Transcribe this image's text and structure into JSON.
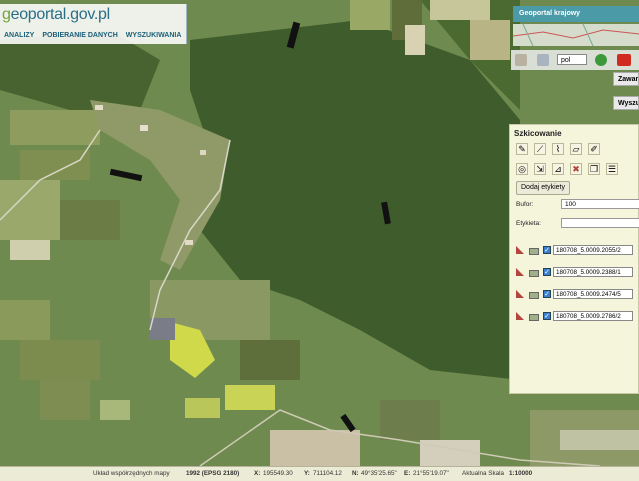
{
  "header": {
    "logo_main": "eoportal.gov.pl",
    "menu": [
      "ANALIZY",
      "POBIERANIE DANYCH",
      "WYSZUKIWANIA"
    ]
  },
  "right_panel": {
    "title": "Geoportal krajowy",
    "language": "pol",
    "side_buttons": [
      "Zawar",
      "Wyszu"
    ]
  },
  "sketch_panel": {
    "title": "Szkicowanie",
    "add_labels_button": "Dodaj etykiety",
    "buffer_label": "Bufor:",
    "buffer_value": "100",
    "label_label": "Etykieta:",
    "label_value": "",
    "rows": [
      "180708_5.0009.2055/2",
      "180708_5.0009.2388/1",
      "180708_5.0009.2474/5",
      "180708_5.0009.2786/2"
    ]
  },
  "status_bar": {
    "coord_system_label": "Układ współrzędnych mapy",
    "coord_system_value": "1992 (EPSG 2180)",
    "x_label": "X:",
    "x_value": "195549.30",
    "y_label": "Y:",
    "y_value": "711104.12",
    "n_label": "N:",
    "n_value": "49°35'25.65\"",
    "e_label": "E:",
    "e_value": "21°55'19.07\"",
    "scale_label": "Aktualna Skala",
    "scale_value": "1:10000"
  },
  "colors": {
    "forest": "#3d5a2a",
    "field_light": "#a8b87a",
    "rapeseed": "#cfd94a",
    "panel_bg": "#f5f5dc",
    "title_bar": "#4b9aa8",
    "accent_red": "#b2453c"
  },
  "icons": [
    "pencil-icon",
    "polygon-icon",
    "buffer-icon",
    "erase-icon",
    "save-icon",
    "print-icon",
    "youtube-icon",
    "globe-icon",
    "help-icon"
  ]
}
